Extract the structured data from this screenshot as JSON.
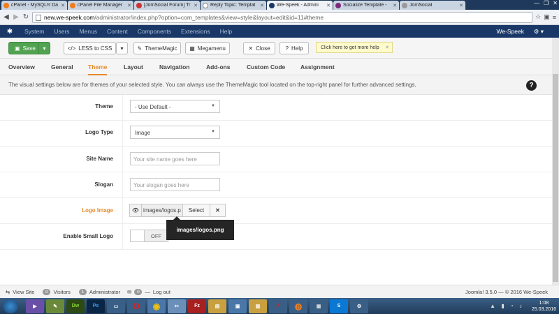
{
  "browser": {
    "tabs": [
      {
        "title": "cPanel - MySQL® Da",
        "color": "#f07d1a",
        "active": false
      },
      {
        "title": "cPanel File Manager",
        "color": "#f07d1a",
        "active": false
      },
      {
        "title": "[JomSocial Forum] Tr",
        "color": "#c33",
        "active": false
      },
      {
        "title": "Reply Topic: Templat",
        "color": "#ffffff",
        "active": false
      },
      {
        "title": "We-Speek - Admini",
        "color": "#1a3867",
        "active": true
      },
      {
        "title": "Socialize Template -",
        "color": "#7a2a7a",
        "active": false
      },
      {
        "title": "JomSocial",
        "color": "#999",
        "active": false
      }
    ],
    "url_domain": "new.we-speek.com",
    "url_path": "/administrator/index.php?option=com_templates&view=style&layout=edit&id=11#theme"
  },
  "adminbar": {
    "menu": [
      "System",
      "Users",
      "Menus",
      "Content",
      "Components",
      "Extensions",
      "Help"
    ],
    "site_name": "We-Speek"
  },
  "toolbar": {
    "save": "Save",
    "less": "LESS to CSS",
    "thememagic": "ThemeMagic",
    "megamenu": "Megamenu",
    "close": "Close",
    "help": "Help",
    "tip": "Click here to get more help"
  },
  "tabs": [
    {
      "label": "Overview",
      "active": false
    },
    {
      "label": "General",
      "active": false
    },
    {
      "label": "Theme",
      "active": true
    },
    {
      "label": "Layout",
      "active": false
    },
    {
      "label": "Navigation",
      "active": false
    },
    {
      "label": "Add-ons",
      "active": false
    },
    {
      "label": "Custom Code",
      "active": false
    },
    {
      "label": "Assignment",
      "active": false
    }
  ],
  "info": "The visual settings below are for themes of your selected style. You can always use the ThemeMagic tool located on the top-right panel for further advanced settings.",
  "form": {
    "theme_label": "Theme",
    "theme_value": "- Use Default -",
    "logotype_label": "Logo Type",
    "logotype_value": "Image",
    "sitename_label": "Site Name",
    "sitename_placeholder": "Your site name goes here",
    "slogan_label": "Slogan",
    "slogan_placeholder": "Your slogan goes here",
    "logoimage_label": "Logo Image",
    "logoimage_value": "images/logos.p",
    "logoimage_select": "Select",
    "logoimage_tooltip": "images/logos.png",
    "smalllogo_label": "Enable Small Logo",
    "smalllogo_value": "OFF"
  },
  "status": {
    "view_site": "View Site",
    "visitors_count": "0",
    "visitors": "Visitors",
    "admin_count": "1",
    "administrator": "Administrator",
    "msg_count": "0",
    "logout": "Log out",
    "copyright": "Joomla! 3.5.0 — © 2016 We-Speek"
  },
  "taskbar": {
    "time": "1:08",
    "date": "25.03.2016"
  },
  "colors": {
    "accent": "#e6892b",
    "save_green": "#51a351",
    "admin_bar": "#1a3867"
  }
}
